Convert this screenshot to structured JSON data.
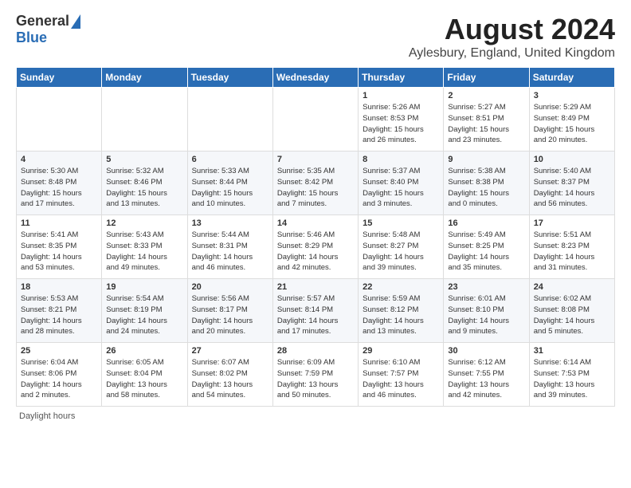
{
  "header": {
    "logo_general": "General",
    "logo_blue": "Blue",
    "title": "August 2024",
    "subtitle": "Aylesbury, England, United Kingdom"
  },
  "days_of_week": [
    "Sunday",
    "Monday",
    "Tuesday",
    "Wednesday",
    "Thursday",
    "Friday",
    "Saturday"
  ],
  "weeks": [
    [
      {
        "day": "",
        "info": ""
      },
      {
        "day": "",
        "info": ""
      },
      {
        "day": "",
        "info": ""
      },
      {
        "day": "",
        "info": ""
      },
      {
        "day": "1",
        "info": "Sunrise: 5:26 AM\nSunset: 8:53 PM\nDaylight: 15 hours\nand 26 minutes."
      },
      {
        "day": "2",
        "info": "Sunrise: 5:27 AM\nSunset: 8:51 PM\nDaylight: 15 hours\nand 23 minutes."
      },
      {
        "day": "3",
        "info": "Sunrise: 5:29 AM\nSunset: 8:49 PM\nDaylight: 15 hours\nand 20 minutes."
      }
    ],
    [
      {
        "day": "4",
        "info": "Sunrise: 5:30 AM\nSunset: 8:48 PM\nDaylight: 15 hours\nand 17 minutes."
      },
      {
        "day": "5",
        "info": "Sunrise: 5:32 AM\nSunset: 8:46 PM\nDaylight: 15 hours\nand 13 minutes."
      },
      {
        "day": "6",
        "info": "Sunrise: 5:33 AM\nSunset: 8:44 PM\nDaylight: 15 hours\nand 10 minutes."
      },
      {
        "day": "7",
        "info": "Sunrise: 5:35 AM\nSunset: 8:42 PM\nDaylight: 15 hours\nand 7 minutes."
      },
      {
        "day": "8",
        "info": "Sunrise: 5:37 AM\nSunset: 8:40 PM\nDaylight: 15 hours\nand 3 minutes."
      },
      {
        "day": "9",
        "info": "Sunrise: 5:38 AM\nSunset: 8:38 PM\nDaylight: 15 hours\nand 0 minutes."
      },
      {
        "day": "10",
        "info": "Sunrise: 5:40 AM\nSunset: 8:37 PM\nDaylight: 14 hours\nand 56 minutes."
      }
    ],
    [
      {
        "day": "11",
        "info": "Sunrise: 5:41 AM\nSunset: 8:35 PM\nDaylight: 14 hours\nand 53 minutes."
      },
      {
        "day": "12",
        "info": "Sunrise: 5:43 AM\nSunset: 8:33 PM\nDaylight: 14 hours\nand 49 minutes."
      },
      {
        "day": "13",
        "info": "Sunrise: 5:44 AM\nSunset: 8:31 PM\nDaylight: 14 hours\nand 46 minutes."
      },
      {
        "day": "14",
        "info": "Sunrise: 5:46 AM\nSunset: 8:29 PM\nDaylight: 14 hours\nand 42 minutes."
      },
      {
        "day": "15",
        "info": "Sunrise: 5:48 AM\nSunset: 8:27 PM\nDaylight: 14 hours\nand 39 minutes."
      },
      {
        "day": "16",
        "info": "Sunrise: 5:49 AM\nSunset: 8:25 PM\nDaylight: 14 hours\nand 35 minutes."
      },
      {
        "day": "17",
        "info": "Sunrise: 5:51 AM\nSunset: 8:23 PM\nDaylight: 14 hours\nand 31 minutes."
      }
    ],
    [
      {
        "day": "18",
        "info": "Sunrise: 5:53 AM\nSunset: 8:21 PM\nDaylight: 14 hours\nand 28 minutes."
      },
      {
        "day": "19",
        "info": "Sunrise: 5:54 AM\nSunset: 8:19 PM\nDaylight: 14 hours\nand 24 minutes."
      },
      {
        "day": "20",
        "info": "Sunrise: 5:56 AM\nSunset: 8:17 PM\nDaylight: 14 hours\nand 20 minutes."
      },
      {
        "day": "21",
        "info": "Sunrise: 5:57 AM\nSunset: 8:14 PM\nDaylight: 14 hours\nand 17 minutes."
      },
      {
        "day": "22",
        "info": "Sunrise: 5:59 AM\nSunset: 8:12 PM\nDaylight: 14 hours\nand 13 minutes."
      },
      {
        "day": "23",
        "info": "Sunrise: 6:01 AM\nSunset: 8:10 PM\nDaylight: 14 hours\nand 9 minutes."
      },
      {
        "day": "24",
        "info": "Sunrise: 6:02 AM\nSunset: 8:08 PM\nDaylight: 14 hours\nand 5 minutes."
      }
    ],
    [
      {
        "day": "25",
        "info": "Sunrise: 6:04 AM\nSunset: 8:06 PM\nDaylight: 14 hours\nand 2 minutes."
      },
      {
        "day": "26",
        "info": "Sunrise: 6:05 AM\nSunset: 8:04 PM\nDaylight: 13 hours\nand 58 minutes."
      },
      {
        "day": "27",
        "info": "Sunrise: 6:07 AM\nSunset: 8:02 PM\nDaylight: 13 hours\nand 54 minutes."
      },
      {
        "day": "28",
        "info": "Sunrise: 6:09 AM\nSunset: 7:59 PM\nDaylight: 13 hours\nand 50 minutes."
      },
      {
        "day": "29",
        "info": "Sunrise: 6:10 AM\nSunset: 7:57 PM\nDaylight: 13 hours\nand 46 minutes."
      },
      {
        "day": "30",
        "info": "Sunrise: 6:12 AM\nSunset: 7:55 PM\nDaylight: 13 hours\nand 42 minutes."
      },
      {
        "day": "31",
        "info": "Sunrise: 6:14 AM\nSunset: 7:53 PM\nDaylight: 13 hours\nand 39 minutes."
      }
    ]
  ],
  "footer": {
    "note": "Daylight hours"
  }
}
